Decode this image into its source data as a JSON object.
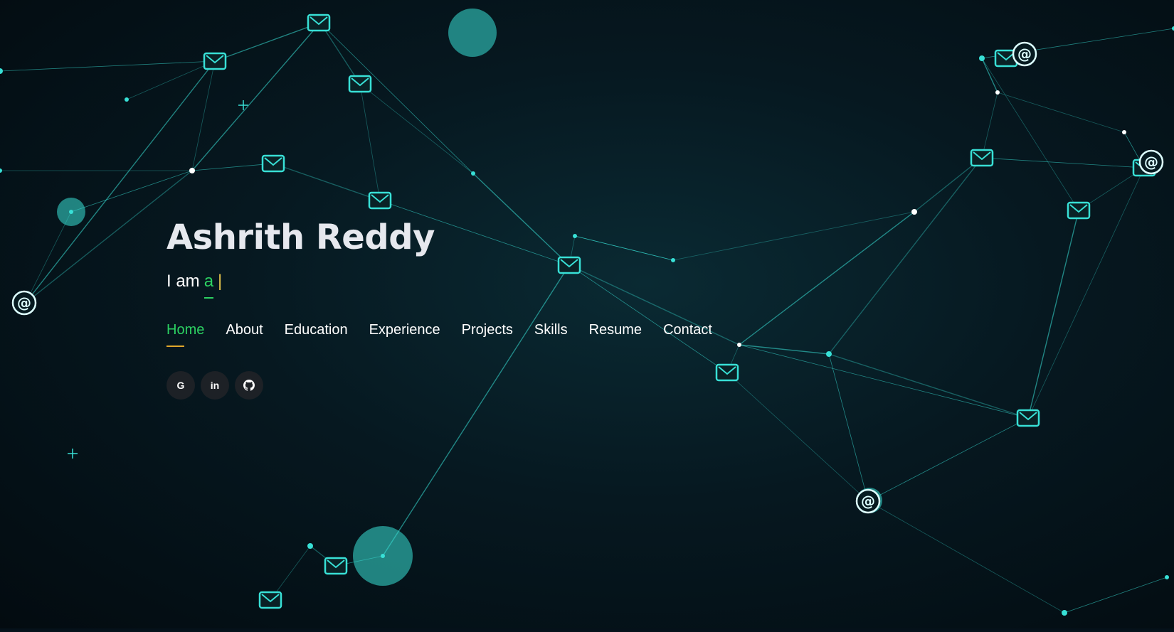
{
  "hero": {
    "name": "Ashrith Reddy",
    "typing_prefix": "I am",
    "typing_word": "a",
    "cursor": "|"
  },
  "nav": {
    "items": [
      {
        "label": "Home",
        "active": true
      },
      {
        "label": "About",
        "active": false
      },
      {
        "label": "Education",
        "active": false
      },
      {
        "label": "Experience",
        "active": false
      },
      {
        "label": "Projects",
        "active": false
      },
      {
        "label": "Skills",
        "active": false
      },
      {
        "label": "Resume",
        "active": false
      },
      {
        "label": "Contact",
        "active": false
      }
    ]
  },
  "social": [
    {
      "name": "google",
      "glyph": "G",
      "icon": "google-icon"
    },
    {
      "name": "linkedin",
      "glyph": "in",
      "icon": "linkedin-icon"
    },
    {
      "name": "github",
      "glyph": "",
      "icon": "github-icon"
    }
  ],
  "colors": {
    "accent": "#2cd162",
    "underline": "#e0a82b",
    "network": "#38e0d6",
    "background": "#05111a"
  }
}
